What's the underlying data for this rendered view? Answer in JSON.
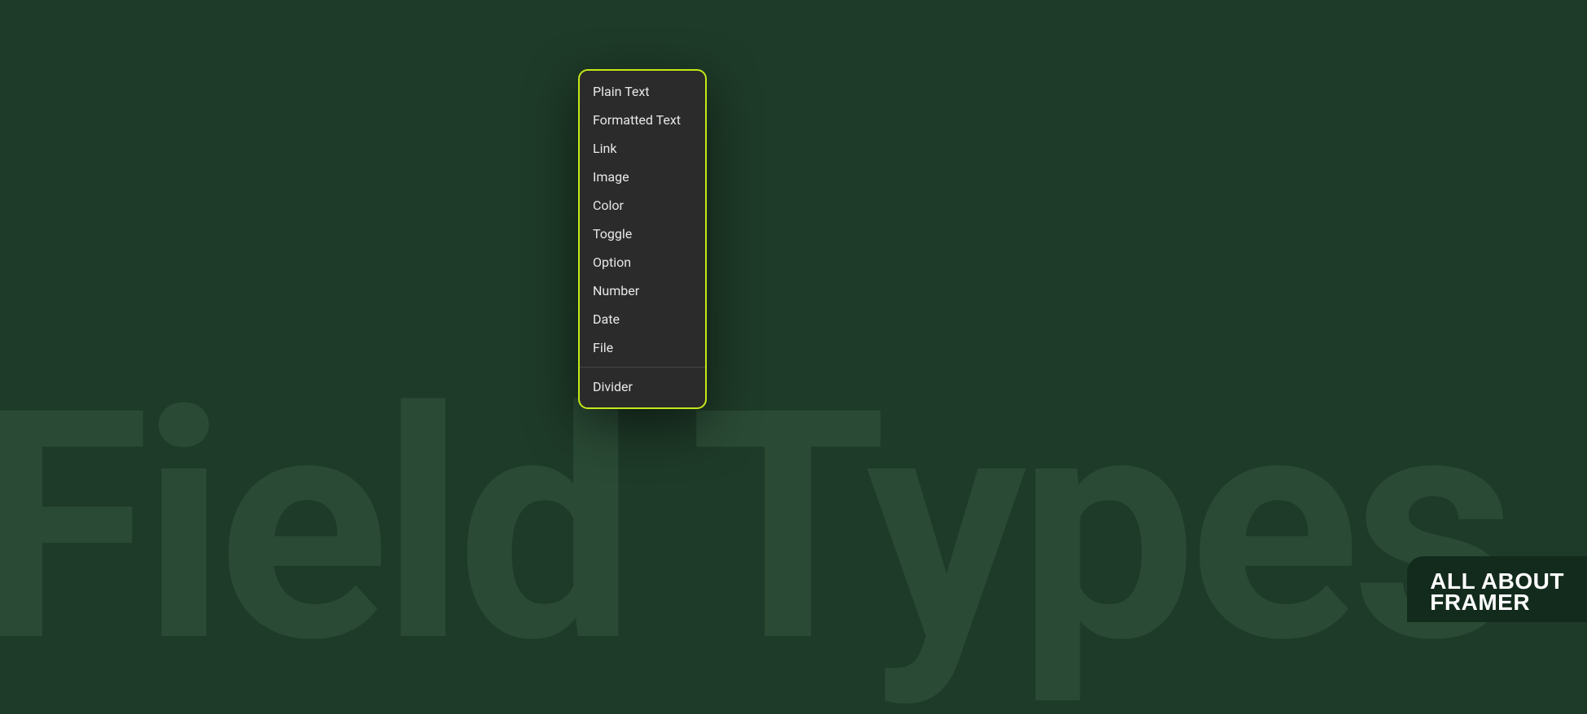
{
  "background": {
    "watermark_text": "Field Types"
  },
  "menu": {
    "items": [
      "Plain Text",
      "Formatted Text",
      "Link",
      "Image",
      "Color",
      "Toggle",
      "Option",
      "Number",
      "Date",
      "File"
    ],
    "divider_item": "Divider"
  },
  "brand": {
    "line1": "ALL ABOUT",
    "line2": "FRAMER"
  }
}
